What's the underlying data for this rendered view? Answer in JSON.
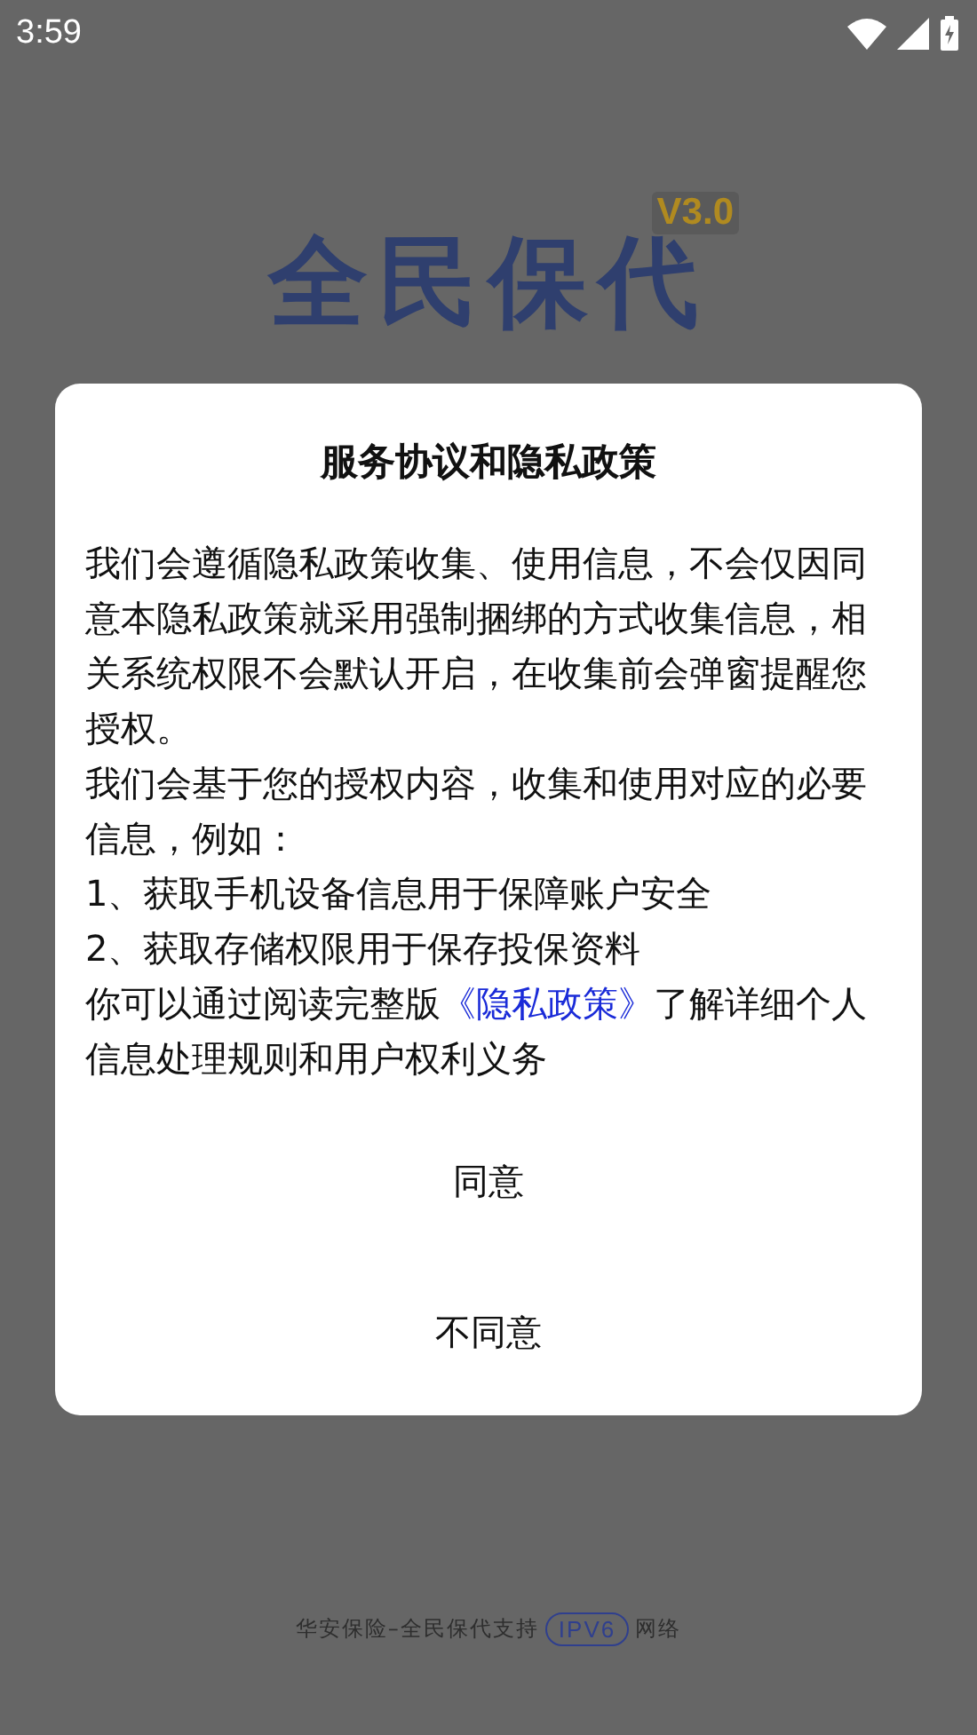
{
  "status_bar": {
    "time": "3:59"
  },
  "splash": {
    "logo": "全民保代",
    "version": "V3.0"
  },
  "footer": {
    "text_before": "华安保险–全民保代支持",
    "badge": "IPV6",
    "text_after": "网络"
  },
  "dialog": {
    "title": "服务协议和隐私政策",
    "paragraphs": [
      {
        "text": "我们会遵循隐私政策收集、使用信息，不会仅因同意本隐私政策就采用强制捆绑的方式收集信息，相关系统权限不会默认开启，在收集前会弹窗提醒您授权。"
      },
      {
        "text": "我们会基于您的授权内容，收集和使用对应的必要信息，例如："
      },
      {
        "text": "1、获取手机设备信息用于保障账户安全"
      },
      {
        "text": "2、获取存储权限用于保存投保资料"
      },
      {
        "text": "你可以通过阅读完整版",
        "link": "《隐私政策》",
        "after": "了解详细个人信息处理规则和用户权利义务"
      }
    ],
    "buttons": [
      "同意",
      "不同意"
    ]
  }
}
